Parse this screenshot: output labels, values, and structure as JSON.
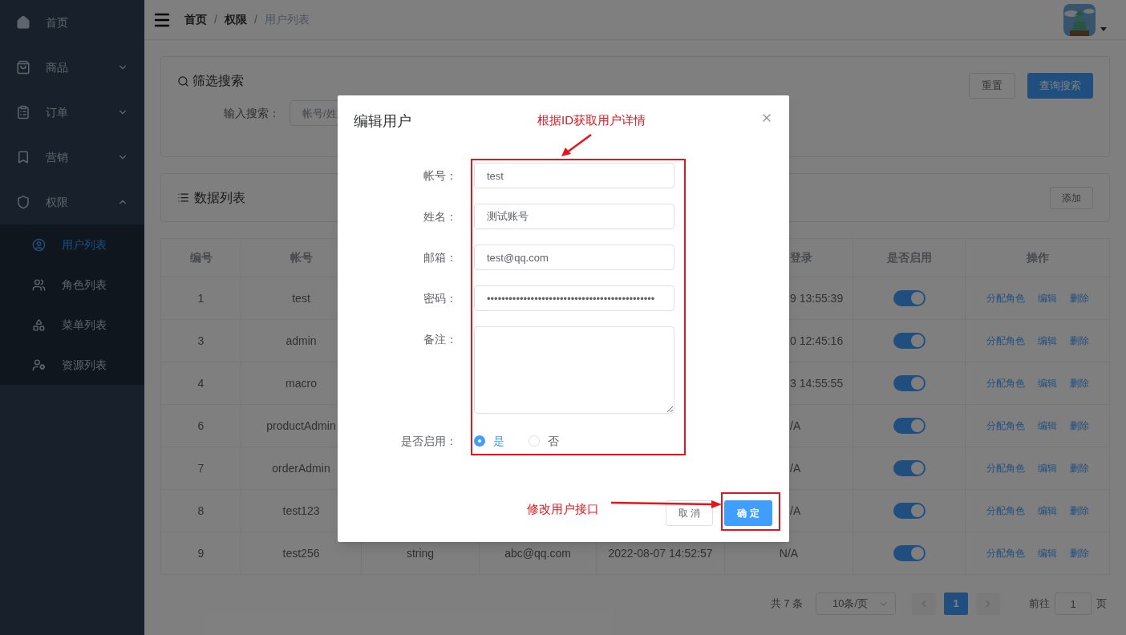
{
  "sidebar": {
    "items": [
      {
        "label": "首页"
      },
      {
        "label": "商品",
        "expanded": false
      },
      {
        "label": "订单",
        "expanded": false
      },
      {
        "label": "营销",
        "expanded": false
      },
      {
        "label": "权限",
        "expanded": true,
        "children": [
          {
            "label": "用户列表",
            "selected": true
          },
          {
            "label": "角色列表",
            "selected": false
          },
          {
            "label": "菜单列表",
            "selected": false
          },
          {
            "label": "资源列表",
            "selected": false
          }
        ]
      }
    ]
  },
  "breadcrumb": [
    "首页",
    "权限",
    "用户列表"
  ],
  "breadcrumb_separators": [
    "/",
    "/"
  ],
  "filter": {
    "title": "筛选搜索",
    "label": "输入搜索：",
    "placeholder": "帐号/姓",
    "buttons": [
      "重置",
      "查询搜索"
    ]
  },
  "data_list": {
    "title": "数据列表",
    "button": "添加"
  },
  "table": {
    "columns": [
      "编号",
      "帐号",
      "登录",
      "是否启用",
      "操作"
    ],
    "rows": [
      {
        "id": "1",
        "account": "test",
        "column_6": "9 13:55:39",
        "enabled": true,
        "actions": [
          "分配角色",
          "编辑",
          "删除"
        ]
      },
      {
        "id": "3",
        "account": "admin",
        "column_6": "0 12:45:16",
        "enabled": true,
        "actions": [
          "分配角色",
          "编辑",
          "删除"
        ]
      },
      {
        "id": "4",
        "account": "macro",
        "column_6": "3 14:55:55",
        "enabled": true,
        "actions": [
          "分配角色",
          "编辑",
          "删除"
        ]
      },
      {
        "id": "6",
        "account": "productAdmin",
        "column_6": "/A",
        "enabled": true,
        "actions": [
          "分配角色",
          "编辑",
          "删除"
        ]
      },
      {
        "id": "7",
        "account": "orderAdmin",
        "column_6": "/A",
        "enabled": true,
        "actions": [
          "分配角色",
          "编辑",
          "删除"
        ]
      },
      {
        "id": "8",
        "account": "test123",
        "column_6": "/A",
        "enabled": true,
        "actions": [
          "分配角色",
          "编辑",
          "删除"
        ]
      },
      {
        "id": "9",
        "account": "test256",
        "column_3": "string",
        "column_4": "abc@qq.com",
        "column_5": "2022-08-07 14:52:57",
        "column_6": "N/A",
        "enabled": true,
        "actions": [
          "分配角色",
          "编辑",
          "删除"
        ]
      }
    ]
  },
  "pagination": {
    "total": "共 7 条",
    "page_size": "10条/页",
    "pages": [
      {
        "label": "1",
        "selected": true
      }
    ],
    "goto_label": "前往",
    "goto_value": "1",
    "goto_suffix": "页"
  },
  "dialog": {
    "title": "编辑用户",
    "fields": [
      {
        "kind": "input",
        "label": "帐号：",
        "value": "test"
      },
      {
        "kind": "input",
        "label": "姓名：",
        "value": "测试账号"
      },
      {
        "kind": "input",
        "label": "邮箱：",
        "value": "test@qq.com"
      },
      {
        "kind": "input",
        "label": "密码：",
        "value": "••••••••••••••••••••••••••••••••••••••••••••••"
      },
      {
        "kind": "textarea",
        "label": "备注："
      }
    ],
    "enabled": {
      "label": "是否启用：",
      "options": [
        {
          "label": "是",
          "selected": true
        },
        {
          "label": "否",
          "selected": false
        }
      ]
    },
    "buttons": {
      "cancel": "取 消",
      "confirm": "确 定"
    },
    "annotations": [
      "根据ID获取用户详情",
      "修改用户接口"
    ]
  }
}
